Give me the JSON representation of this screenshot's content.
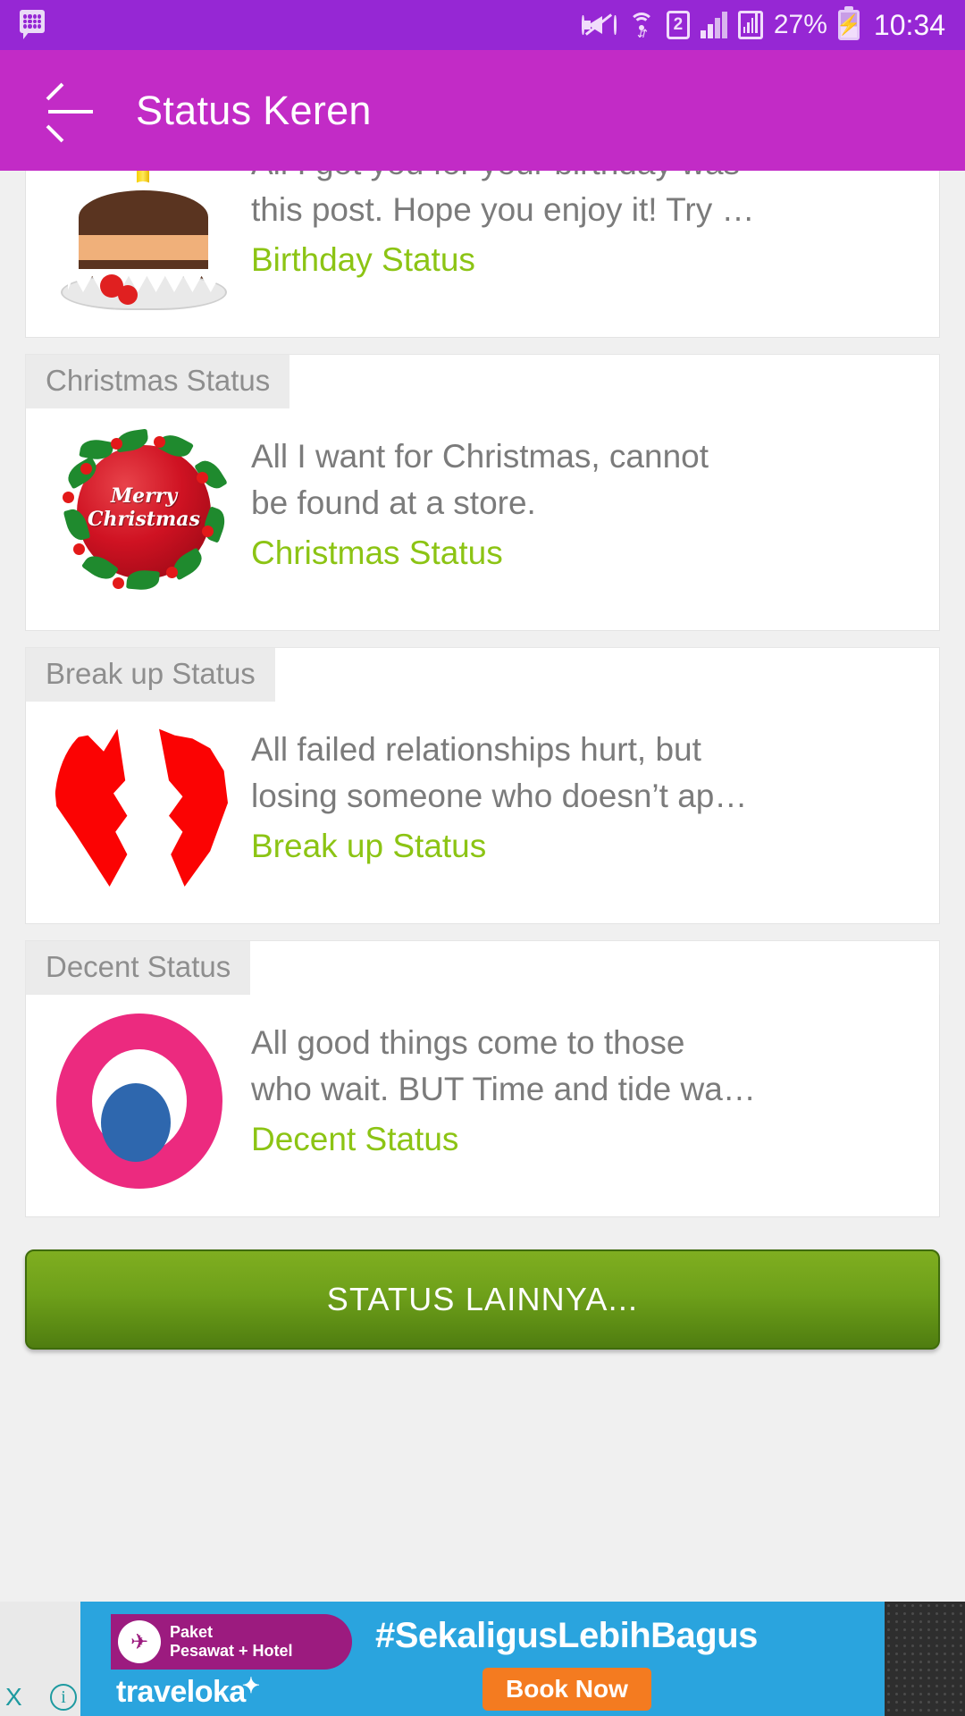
{
  "statusbar": {
    "notification_icon": "bbm-message-icon",
    "mute_icon": "volume-mute-icon",
    "wifi_icon": "wifi-icon",
    "sim_label": "2",
    "signal_icon": "signal-bars-icon",
    "signal2_icon": "signal-strength-boxed-icon",
    "battery_percent": "27%",
    "battery_icon": "battery-charging-icon",
    "time": "10:34"
  },
  "appbar": {
    "back_icon": "back-arrow-icon",
    "title": "Status Keren"
  },
  "theme": {
    "statusbar_bg": "#9627d4",
    "appbar_bg": "#c22bc6",
    "category_green": "#8cc414",
    "button_green_top": "#7fae20",
    "button_green_bottom": "#4f7d10",
    "quote_gray": "#7b7b7b",
    "section_header_gray": "#8e8e8e"
  },
  "list": [
    {
      "section": null,
      "thumb": "birthday-cake-icon",
      "quote": "All I got you for your birthday was\nthis post. Hope you enjoy it! Try …",
      "category": "Birthday Status"
    },
    {
      "section": "Christmas Status",
      "thumb": "christmas-ornament-icon",
      "ornament_text": "Merry\nChristmas",
      "quote": "All I want for Christmas, cannot\nbe found at a store.",
      "category": "Christmas Status"
    },
    {
      "section": "Break up Status",
      "thumb": "broken-heart-icon",
      "quote": "All failed relationships hurt, but\nlosing someone who doesn’t ap…",
      "category": "Break up Status"
    },
    {
      "section": "Decent Status",
      "thumb": "decent-circle-icon",
      "quote": "All good things come to those\nwho wait. BUT Time and tide wa…",
      "category": "Decent Status"
    }
  ],
  "more_button": {
    "label": "STATUS LAINNYA..."
  },
  "ad": {
    "close_label": "X",
    "info_label": "i",
    "badge_line1": "Paket",
    "badge_line2": "Pesawat + Hotel",
    "brand": "traveloka",
    "hashtag": "#SekaligusLebihBagus",
    "cta": "Book Now"
  }
}
